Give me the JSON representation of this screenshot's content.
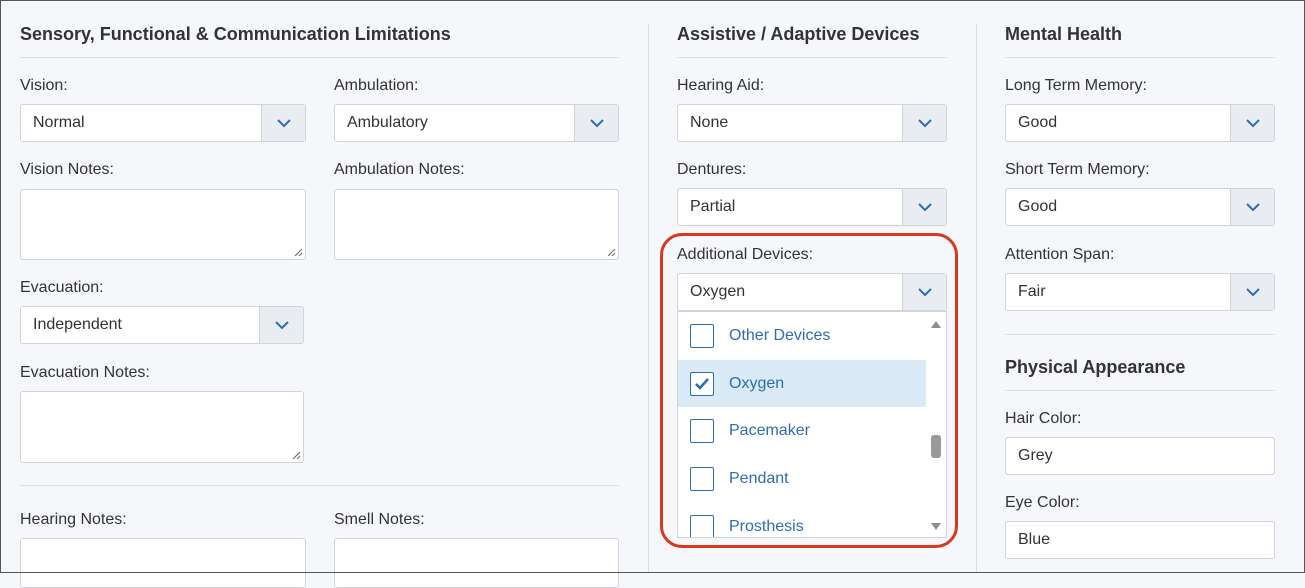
{
  "sensory": {
    "title": "Sensory, Functional & Communication Limitations",
    "vision_label": "Vision:",
    "vision_value": "Normal",
    "ambulation_label": "Ambulation:",
    "ambulation_value": "Ambulatory",
    "vision_notes_label": "Vision Notes:",
    "ambulation_notes_label": "Ambulation Notes:",
    "evacuation_label": "Evacuation:",
    "evacuation_value": "Independent",
    "evacuation_notes_label": "Evacuation Notes:",
    "hearing_notes_label": "Hearing Notes:",
    "smell_notes_label": "Smell Notes:"
  },
  "devices": {
    "title": "Assistive / Adaptive Devices",
    "hearing_aid_label": "Hearing Aid:",
    "hearing_aid_value": "None",
    "dentures_label": "Dentures:",
    "dentures_value": "Partial",
    "additional_label": "Additional Devices:",
    "additional_value": "Oxygen",
    "options": [
      {
        "label": "Other Devices",
        "checked": false
      },
      {
        "label": "Oxygen",
        "checked": true
      },
      {
        "label": "Pacemaker",
        "checked": false
      },
      {
        "label": "Pendant",
        "checked": false
      },
      {
        "label": "Prosthesis",
        "checked": false
      }
    ]
  },
  "mental": {
    "title": "Mental Health",
    "long_term_label": "Long Term Memory:",
    "long_term_value": "Good",
    "short_term_label": "Short Term Memory:",
    "short_term_value": "Good",
    "attention_label": "Attention Span:",
    "attention_value": "Fair"
  },
  "physical": {
    "title": "Physical Appearance",
    "hair_label": "Hair Color:",
    "hair_value": "Grey",
    "eye_label": "Eye Color:",
    "eye_value": "Blue"
  },
  "colors": {
    "accent": "#2e6db4",
    "highlight": "#d9381e",
    "selected_bg": "#dbeaf7"
  }
}
